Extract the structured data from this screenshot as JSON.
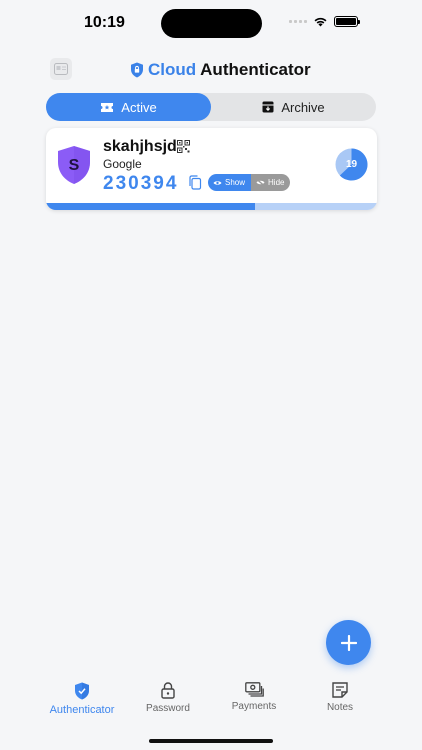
{
  "status_bar": {
    "time": "10:19"
  },
  "header": {
    "brand": "Cloud",
    "title_rest": "Authenticator"
  },
  "tabs": [
    {
      "label": "Active",
      "active": true,
      "icon": "ticket-icon"
    },
    {
      "label": "Archive",
      "active": false,
      "icon": "archive-box-icon"
    }
  ],
  "account": {
    "name": "skahjhsjd",
    "issuer": "Google",
    "avatar_letter": "S",
    "code": "230394",
    "show_label": "Show",
    "hide_label": "Hide",
    "timer": "19",
    "timer_fraction": 0.63,
    "progress_fraction": 0.63
  },
  "bottom_nav": [
    {
      "label": "Authenticator",
      "icon": "shield-icon",
      "active": true
    },
    {
      "label": "Password",
      "icon": "lock-icon",
      "active": false
    },
    {
      "label": "Payments",
      "icon": "cash-icon",
      "active": false
    },
    {
      "label": "Notes",
      "icon": "note-icon",
      "active": false
    }
  ],
  "colors": {
    "accent": "#3f87ee",
    "avatar": "#8b5cf6",
    "track": "#b7d1f7"
  }
}
